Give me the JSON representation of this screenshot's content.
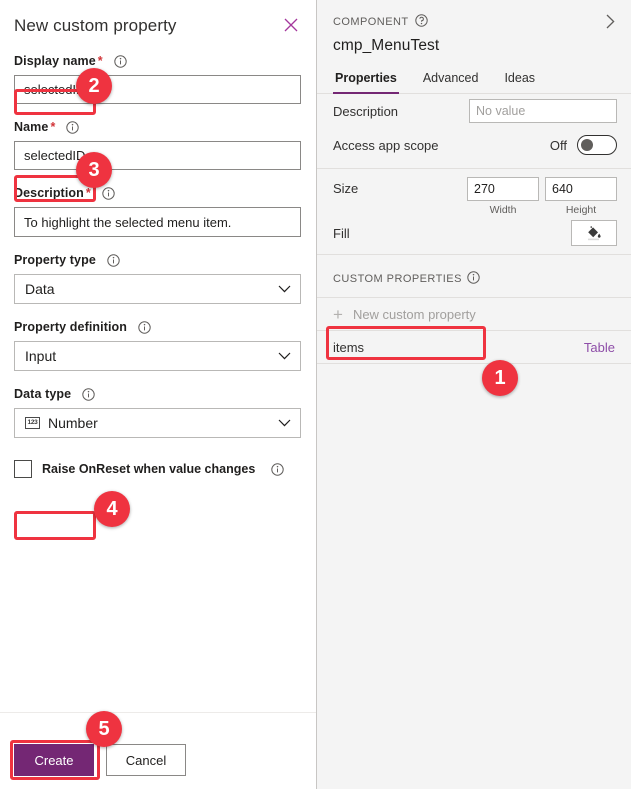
{
  "dialog": {
    "title": "New custom property",
    "close_icon": "close-icon",
    "fields": [
      {
        "label": "Display name",
        "required": true,
        "info": true,
        "value": "selectedID",
        "placeholder": ""
      },
      {
        "label": "Name",
        "required": true,
        "info": true,
        "value": "selectedID",
        "placeholder": ""
      },
      {
        "label": "Description",
        "required": true,
        "info": true,
        "value": "To highlight the selected menu item.",
        "placeholder": ""
      }
    ],
    "property_type": {
      "label": "Property type",
      "info": true,
      "value": "Data"
    },
    "property_definition": {
      "label": "Property definition",
      "info": true,
      "value": "Input"
    },
    "data_type": {
      "label": "Data type",
      "info": true,
      "value": "Number",
      "icon": "number-123-icon"
    },
    "checkbox": {
      "label": "Raise OnReset when value changes",
      "checked": false,
      "info": true
    },
    "buttons": {
      "create": "Create",
      "cancel": "Cancel"
    }
  },
  "panel": {
    "eyebrow": "COMPONENT",
    "component_name": "cmp_MenuTest",
    "collapse_icon": "chevron-right-icon",
    "help_icon": "help-circle-icon",
    "tabs": [
      {
        "label": "Properties",
        "active": true
      },
      {
        "label": "Advanced",
        "active": false
      },
      {
        "label": "Ideas",
        "active": false
      }
    ],
    "properties": {
      "description": {
        "label": "Description",
        "value": "No value"
      },
      "access_app_scope": {
        "label": "Access app scope",
        "state": "Off"
      },
      "size": {
        "label": "Size",
        "width": "270",
        "height": "640",
        "width_caption": "Width",
        "height_caption": "Height"
      },
      "fill": {
        "label": "Fill",
        "icon": "paint-bucket-icon"
      }
    },
    "custom_properties": {
      "header": "CUSTOM PROPERTIES",
      "new_label": "New custom property",
      "items": [
        {
          "name": "items",
          "type": "Table"
        }
      ]
    }
  },
  "annotations": {
    "badges": [
      {
        "n": "1"
      },
      {
        "n": "2"
      },
      {
        "n": "3"
      },
      {
        "n": "4"
      },
      {
        "n": "5"
      }
    ],
    "highlight_color": "#ef3340"
  }
}
